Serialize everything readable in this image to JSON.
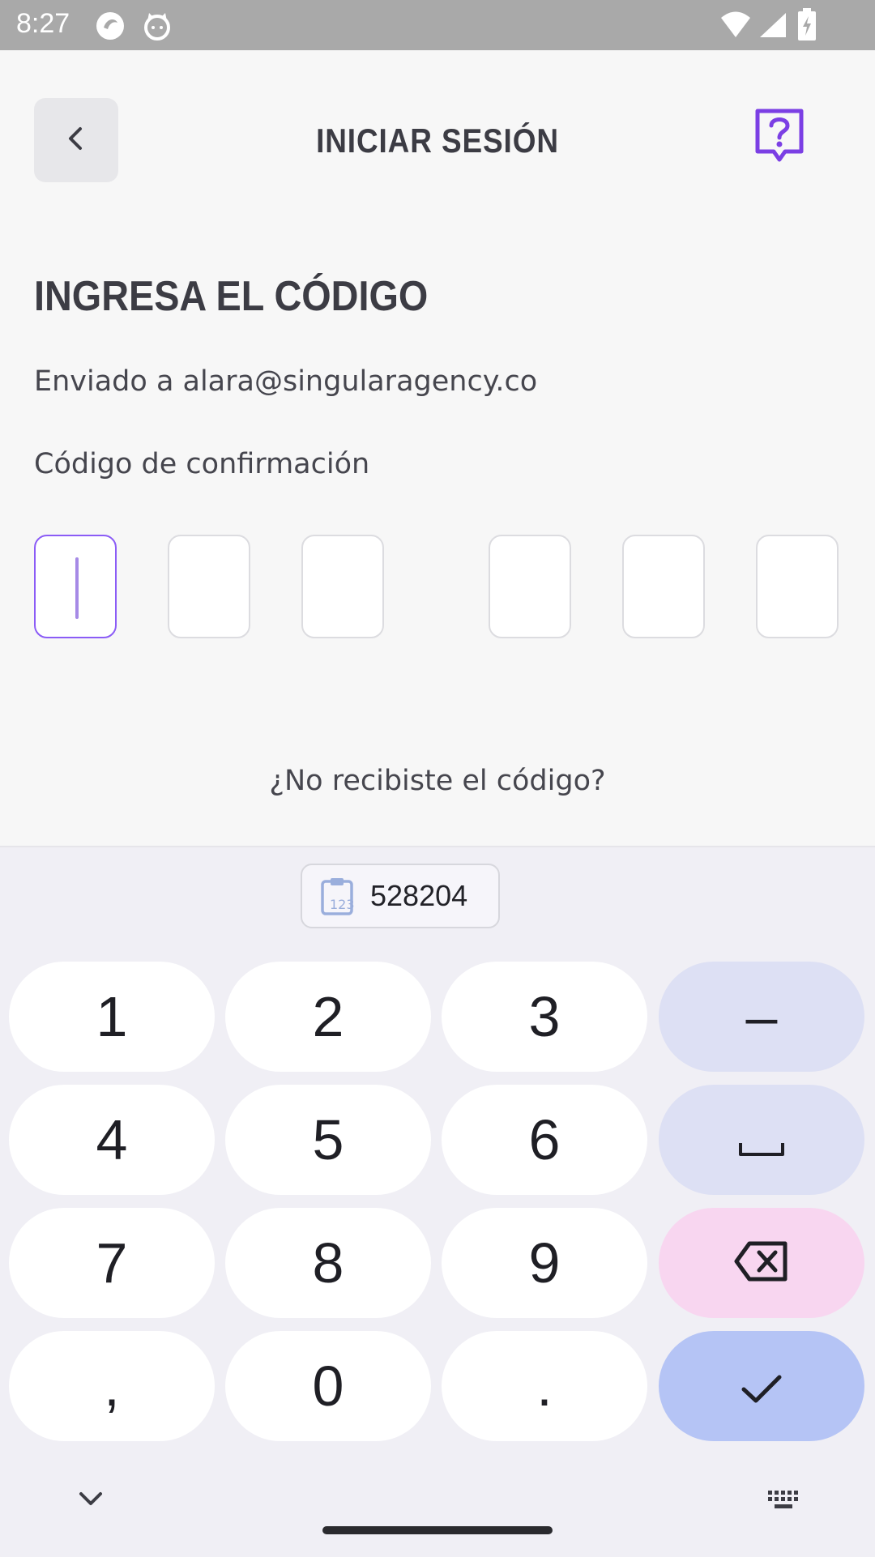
{
  "status_bar": {
    "time": "8:27",
    "icons": [
      "app-notification-icon",
      "cat-notification-icon",
      "wifi-icon",
      "signal-icon",
      "battery-charging-icon"
    ]
  },
  "header": {
    "title": "INICIAR SESIÓN",
    "back_icon": "chevron-left-icon",
    "help_icon": "help-chat-icon",
    "accent": "#7b3fe4"
  },
  "main": {
    "heading": "INGRESA EL CÓDIGO",
    "sent_to": "Enviado a alara@singularagency.co",
    "code_label": "Código de confirmación",
    "code_digits": [
      "",
      "",
      "",
      "",
      "",
      ""
    ],
    "active_box": 0,
    "resend_link": "¿No recibiste el código?"
  },
  "keyboard": {
    "suggestion": {
      "icon": "clipboard-numbers-icon",
      "value": "528204"
    },
    "keys": {
      "k1": "1",
      "k2": "2",
      "k3": "3",
      "minus": "–",
      "k4": "4",
      "k5": "5",
      "k6": "6",
      "k7": "7",
      "k8": "8",
      "k9": "9",
      "comma": ",",
      "k0": "0",
      "period": "."
    },
    "special_icons": [
      "space-icon",
      "backspace-icon",
      "check-icon",
      "collapse-keyboard-icon",
      "keyboard-switch-icon"
    ],
    "colors": {
      "func": "#dde0f4",
      "delete": "#f8d6f0",
      "enter": "#b5c4f5"
    }
  }
}
